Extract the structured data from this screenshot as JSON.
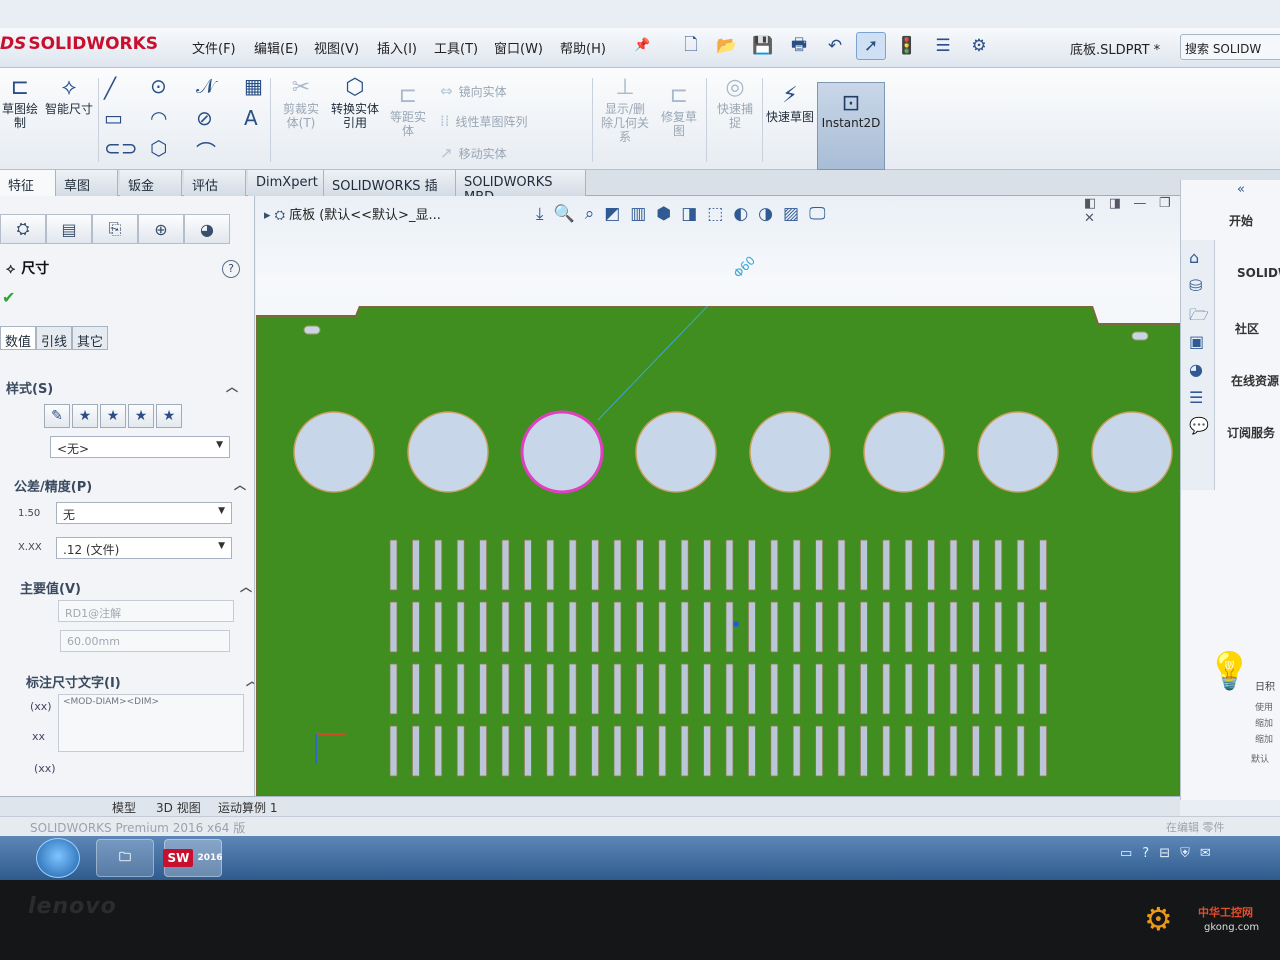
{
  "app": {
    "logo_ds": "DS",
    "logo_text": "SOLIDWORKS",
    "filename": "底板.SLDPRT *",
    "search_placeholder": "搜索 SOLIDW"
  },
  "menu": [
    "文件(F)",
    "编辑(E)",
    "视图(V)",
    "插入(I)",
    "工具(T)",
    "窗口(W)",
    "帮助(H)"
  ],
  "ribbon": {
    "sketch": "草图绘制",
    "smart_dim": "智能尺寸",
    "trim": "剪裁实体(T)",
    "convert": "转换实体引用",
    "offset": "等距实体",
    "mirror": "镜向实体",
    "linear_pattern": "线性草图阵列",
    "move": "移动实体",
    "show_delete": "显示/删除几何关系",
    "repair": "修复草图",
    "quick_snap": "快速捕捉",
    "rapid_sketch": "快速草图",
    "instant2d": "Instant2D"
  },
  "tabs": [
    "特征",
    "草图",
    "钣金",
    "评估",
    "DimXpert",
    "SOLIDWORKS 插件",
    "SOLIDWORKS MBD"
  ],
  "pm": {
    "title": "尺寸",
    "help": "?",
    "ok": "✔",
    "subtabs": [
      "数值",
      "引线",
      "其它"
    ],
    "style_header": "样式(S)",
    "style_value": "<无>",
    "tol_header": "公差/精度(P)",
    "tol_icon_label": "1.50",
    "tol_value": "无",
    "precision_icon_label": "X.XX",
    "precision_value": ".12 (文件)",
    "primary_header": "主要值(V)",
    "primary_name": "RD1@注解",
    "primary_value": "60.00mm",
    "text_header": "标注尺寸文字(I)",
    "text_value": "<MOD-DIAM><DIM>",
    "text_icon_1": "(xx)",
    "text_icon_2": "xx",
    "text_icon_3": "(xx)"
  },
  "viewport": {
    "tree_label": "底板 (默认<<默认>_显...",
    "dimension_label": "Φ60",
    "hole_count": 8,
    "slot_rows": 4,
    "slot_cols": 30,
    "colors": {
      "board": "#3f8e1f",
      "hole": "#c7d6e8",
      "select": "#e040c0",
      "dim_line": "#3aa8d8"
    }
  },
  "taskpane": {
    "items": [
      "开始",
      "SOLIDW",
      "社区",
      "在线资源",
      "订阅服务"
    ],
    "hint_title": "日积",
    "hint_lines": [
      "使用",
      "缩加",
      "缩加",
      "默认"
    ]
  },
  "bottom_tabs": [
    "模型",
    "3D 视图",
    "运动算例 1"
  ],
  "status": {
    "left": "SOLIDWORKS Premium 2016 x64 版",
    "right": "在编辑 零件"
  },
  "taskbar": {
    "sw_label": "SW",
    "sw_year": "2016"
  },
  "bezel": {
    "brand": "lenovo",
    "watermark_cn": "中华工控网",
    "watermark_url": "gkong.com"
  }
}
